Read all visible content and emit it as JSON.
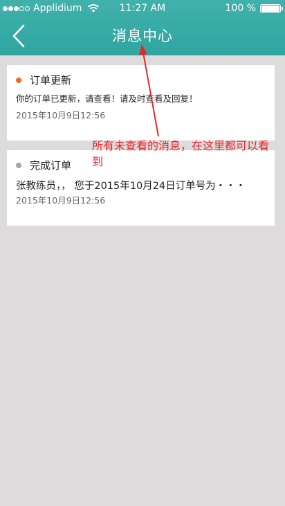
{
  "status_bar": {
    "carrier": "Applidium",
    "time": "11:27 AM",
    "battery": "100 %"
  },
  "nav": {
    "title": "消息中心",
    "back_icon": "chevron-left-icon"
  },
  "messages": [
    {
      "title": "订单更新",
      "body": "你的订单已更新，请查看！请及时查看及回复！",
      "time": "2015年10月9日12:56",
      "dot_color": "#f06a1e"
    },
    {
      "title": "完成订单",
      "body": "张教练员，， 您于2015年10月24日订单号为・・・",
      "time": "2015年10月9日12:56",
      "dot_color": "#a5a5a5"
    }
  ],
  "annotation": {
    "text": "所有未查看的消息，在这里都可以看到",
    "color": "#e8262a"
  },
  "colors": {
    "header": "#35aaa5",
    "background": "#dddbdc"
  }
}
